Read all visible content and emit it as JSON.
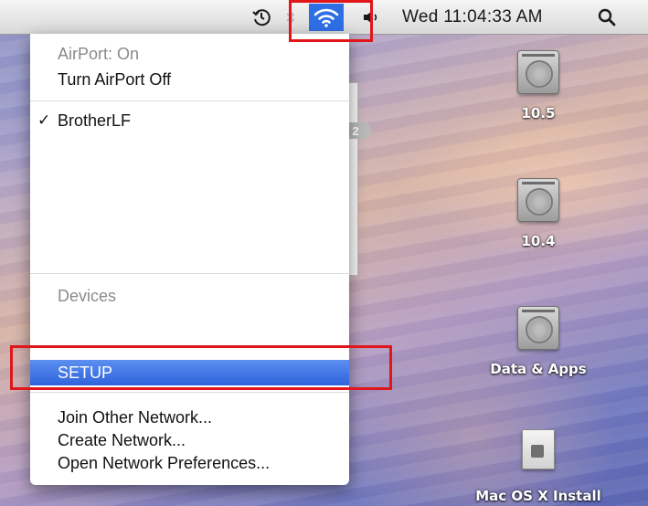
{
  "menubar": {
    "clock": "Wed 11:04:33 AM",
    "icons": {
      "time_machine": "time-machine-icon",
      "bluetooth": "bluetooth-icon",
      "wifi": "wifi-icon",
      "volume": "volume-icon",
      "spotlight": "spotlight-search-icon"
    }
  },
  "airport_menu": {
    "status": "AirPort: On",
    "toggle": "Turn AirPort Off",
    "networks": [
      {
        "name": "BrotherLF",
        "checked": true,
        "check_mark": "✓"
      }
    ],
    "devices_header": "Devices",
    "devices": [
      {
        "name": "SETUP",
        "selected": true
      }
    ],
    "actions": [
      "Join Other Network...",
      "Create Network...",
      "Open Network Preferences..."
    ]
  },
  "desktop": {
    "icons": [
      {
        "label": "10.5",
        "kind": "hard-drive"
      },
      {
        "label": "10.4",
        "kind": "hard-drive"
      },
      {
        "label": "Data & Apps",
        "kind": "hard-drive"
      },
      {
        "label": "Mac OS X Install",
        "kind": "document"
      }
    ],
    "hidden_badge": "2"
  },
  "colors": {
    "highlight_red": "#e0161a",
    "selection_blue": "#2f63dc",
    "wifi_active_blue": "#2f6fe6"
  }
}
